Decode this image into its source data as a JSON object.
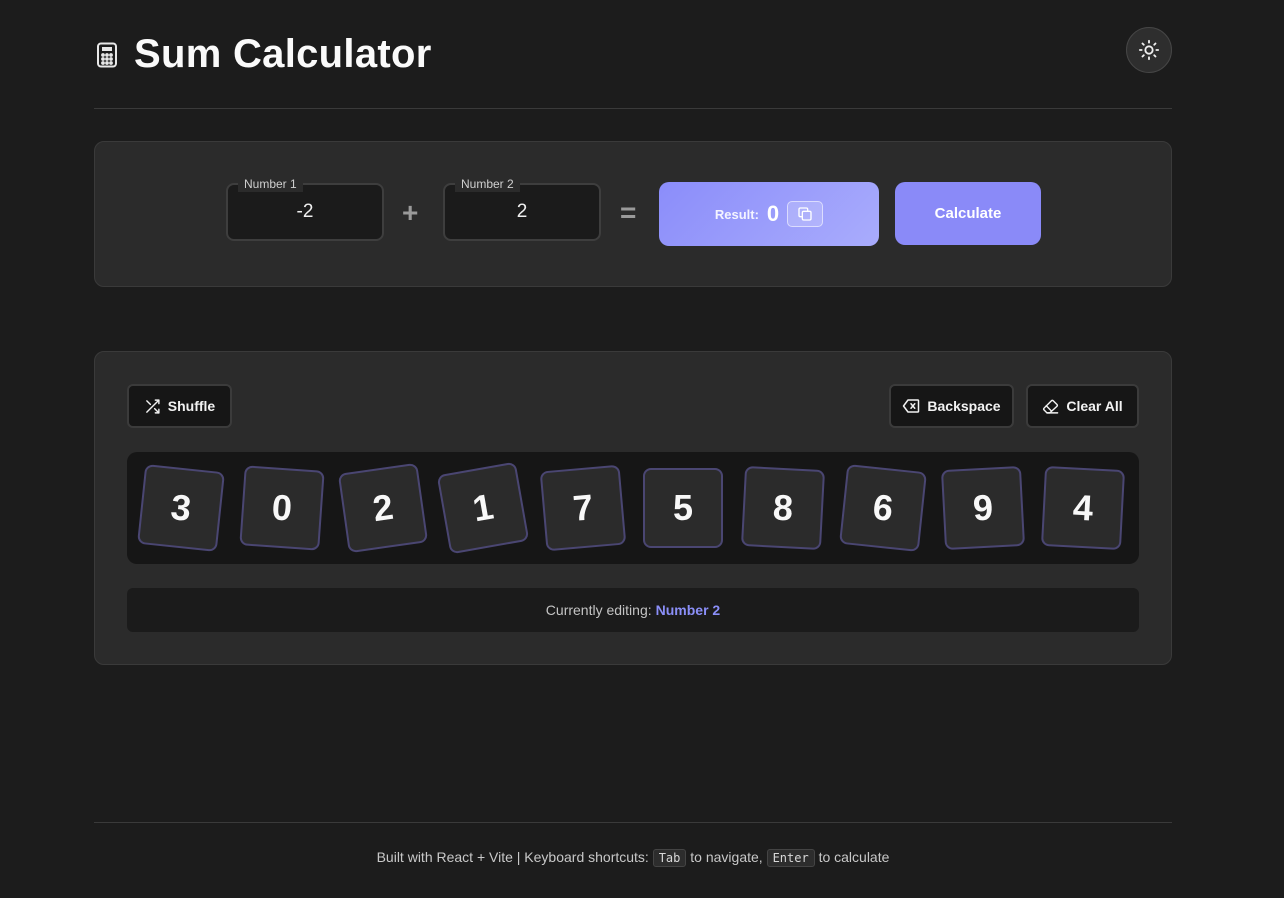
{
  "app": {
    "title": "Sum Calculator",
    "title_icon": "calculator-icon",
    "theme_toggle_icon": "sun-icon"
  },
  "calculator": {
    "number1": {
      "label": "Number 1",
      "value": "-2"
    },
    "operator": "+",
    "number2": {
      "label": "Number 2",
      "value": "2"
    },
    "equals": "=",
    "result": {
      "label": "Result:",
      "value": "0",
      "copy_icon": "copy-icon"
    },
    "calculate_label": "Calculate"
  },
  "keypad": {
    "shuffle_label": "Shuffle",
    "shuffle_icon": "shuffle-icon",
    "backspace_label": "Backspace",
    "backspace_icon": "backspace-icon",
    "clear_label": "Clear All",
    "clear_icon": "eraser-icon",
    "digits": [
      "3",
      "0",
      "2",
      "1",
      "7",
      "5",
      "8",
      "6",
      "9",
      "4"
    ],
    "status_prefix": "Currently editing:",
    "status_target": "Number 2"
  },
  "footer": {
    "prefix": "Built with React + Vite | Keyboard shortcuts:",
    "key1": "Tab",
    "mid": "to navigate,",
    "key2": "Enter",
    "suffix": "to calculate"
  },
  "colors": {
    "background": "#1c1c1c",
    "card": "#2b2b2b",
    "accent": "#8a8af8",
    "tile_border": "#4a4672"
  }
}
